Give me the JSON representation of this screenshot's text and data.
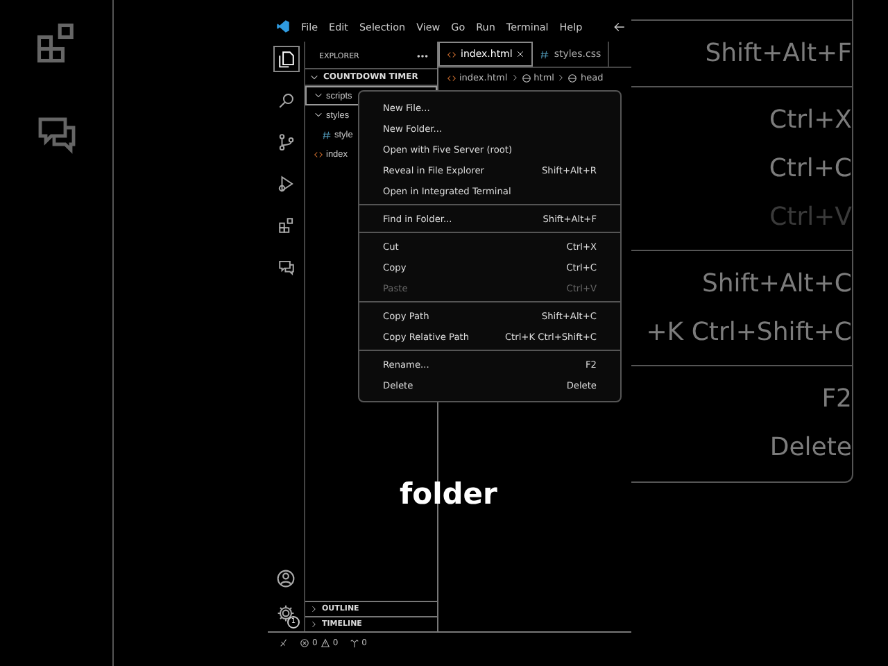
{
  "backdrop": {
    "shortcut_groups": [
      [
        {
          "text": "Shift+Alt+F",
          "disabled": false
        }
      ],
      [
        {
          "text": "Ctrl+X",
          "disabled": false
        },
        {
          "text": "Ctrl+C",
          "disabled": false
        },
        {
          "text": "Ctrl+V",
          "disabled": true
        }
      ],
      [
        {
          "text": "Shift+Alt+C",
          "disabled": false
        },
        {
          "text": "+K Ctrl+Shift+C",
          "disabled": false
        }
      ],
      [
        {
          "text": "F2",
          "disabled": false
        },
        {
          "text": "Delete",
          "disabled": false
        }
      ]
    ]
  },
  "title_bar": {
    "menus": [
      "File",
      "Edit",
      "Selection",
      "View",
      "Go",
      "Run",
      "Terminal",
      "Help"
    ]
  },
  "activity_bar": {
    "items": [
      {
        "kind": "explorer",
        "selected": true
      },
      {
        "kind": "search",
        "selected": false
      },
      {
        "kind": "source-control",
        "selected": false
      },
      {
        "kind": "run",
        "selected": false
      },
      {
        "kind": "extensions",
        "selected": false
      },
      {
        "kind": "remote",
        "selected": false
      }
    ],
    "settings_badge": "1"
  },
  "explorer": {
    "title": "EXPLORER",
    "folder": "COUNTDOWN TIMER",
    "tree": [
      {
        "label": "scripts",
        "kind": "folder",
        "expanded": true,
        "selected": true
      },
      {
        "label": "styles",
        "kind": "folder",
        "expanded": true,
        "selected": false,
        "children": [
          {
            "label": "style",
            "kind": "css",
            "selected": false
          }
        ]
      },
      {
        "label": "index",
        "kind": "html",
        "selected": false
      }
    ],
    "panels": [
      "OUTLINE",
      "TIMELINE"
    ]
  },
  "editor": {
    "tabs": [
      {
        "label": "index.html",
        "kind": "html",
        "selected": true
      },
      {
        "label": "styles.css",
        "kind": "css",
        "selected": false
      }
    ],
    "breadcrumb": [
      "index.html",
      "html",
      "head"
    ]
  },
  "context_menu": {
    "groups": [
      [
        {
          "label": "New File...",
          "disabled": false
        },
        {
          "label": "New Folder...",
          "disabled": false
        },
        {
          "label": "Open with Five Server (root)",
          "disabled": false
        },
        {
          "label": "Reveal in File Explorer",
          "shortcut": "Shift+Alt+R",
          "disabled": false
        },
        {
          "label": "Open in Integrated Terminal",
          "disabled": false
        }
      ],
      [
        {
          "label": "Find in Folder...",
          "shortcut": "Shift+Alt+F",
          "disabled": false
        }
      ],
      [
        {
          "label": "Cut",
          "shortcut": "Ctrl+X",
          "disabled": false
        },
        {
          "label": "Copy",
          "shortcut": "Ctrl+C",
          "disabled": false
        },
        {
          "label": "Paste",
          "shortcut": "Ctrl+V",
          "disabled": true
        }
      ],
      [
        {
          "label": "Copy Path",
          "shortcut": "Shift+Alt+C",
          "disabled": false
        },
        {
          "label": "Copy Relative Path",
          "shortcut": "Ctrl+K Ctrl+Shift+C",
          "disabled": false
        }
      ],
      [
        {
          "label": "Rename...",
          "shortcut": "F2",
          "disabled": false
        },
        {
          "label": "Delete",
          "shortcut": "Delete",
          "disabled": false
        }
      ]
    ]
  },
  "status_bar": {
    "errors": "0",
    "warnings": "0",
    "ports": "0"
  },
  "caption": "folder"
}
